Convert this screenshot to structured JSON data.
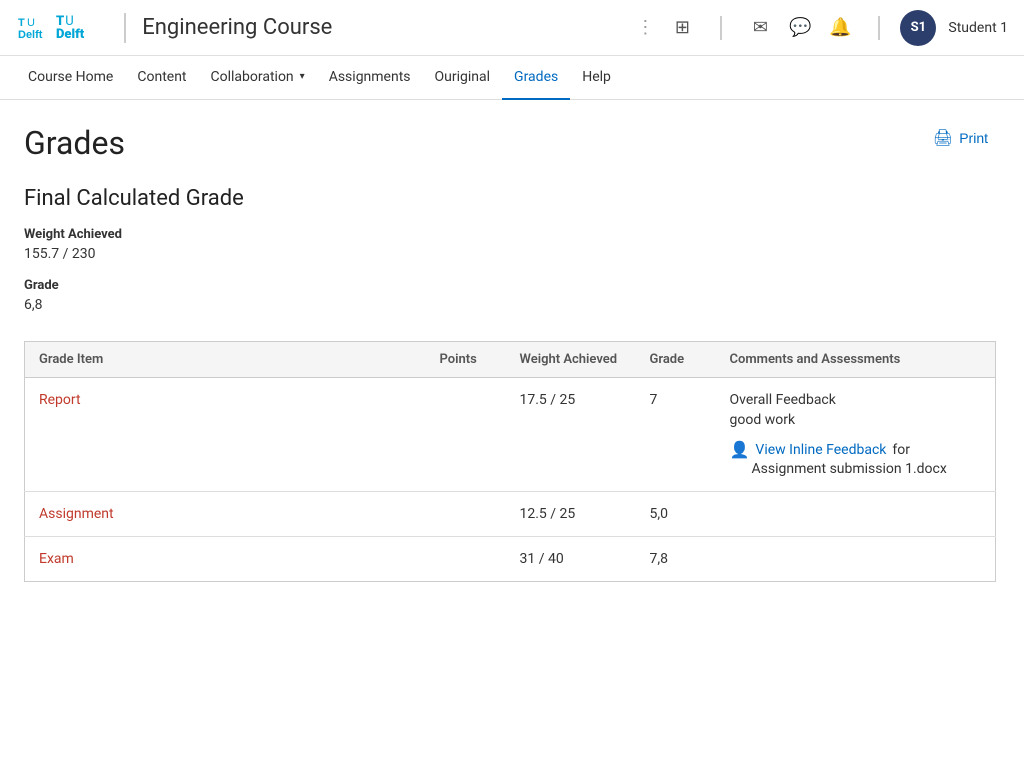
{
  "header": {
    "logo_text": "TUDelft",
    "logo_t": "T",
    "logo_u": "U",
    "logo_delft": "Delft",
    "course_title": "Engineering Course",
    "icons": {
      "grid": "⊞",
      "mail": "✉",
      "chat": "💬",
      "bell": "🔔"
    },
    "user_initials": "S1",
    "user_name": "Student 1"
  },
  "nav": {
    "items": [
      {
        "label": "Course Home",
        "active": false
      },
      {
        "label": "Content",
        "active": false
      },
      {
        "label": "Collaboration",
        "active": false,
        "dropdown": true
      },
      {
        "label": "Assignments",
        "active": false
      },
      {
        "label": "Ouriginal",
        "active": false
      },
      {
        "label": "Grades",
        "active": true
      },
      {
        "label": "Help",
        "active": false
      }
    ]
  },
  "page": {
    "title": "Grades",
    "print_label": "Print"
  },
  "final_grade": {
    "section_title": "Final Calculated Grade",
    "weight_label": "Weight Achieved",
    "weight_value": "155.7 / 230",
    "grade_label": "Grade",
    "grade_value": "6,8"
  },
  "table": {
    "columns": {
      "item": "Grade Item",
      "points": "Points",
      "weight": "Weight Achieved",
      "grade": "Grade",
      "comments": "Comments and Assessments"
    },
    "rows": [
      {
        "item": "Report",
        "points": "",
        "weight": "17.5 / 25",
        "grade": "7",
        "feedback_overall_label": "Overall Feedback",
        "feedback_text": "good work",
        "inline_feedback_label": "View Inline Feedback",
        "inline_feedback_suffix": "for",
        "inline_feedback_file": "Assignment submission 1.docx"
      },
      {
        "item": "Assignment",
        "points": "",
        "weight": "12.5 / 25",
        "grade": "5,0",
        "feedback_overall_label": "",
        "feedback_text": "",
        "inline_feedback_label": "",
        "inline_feedback_suffix": "",
        "inline_feedback_file": ""
      },
      {
        "item": "Exam",
        "points": "",
        "weight": "31 / 40",
        "grade": "7,8",
        "feedback_overall_label": "",
        "feedback_text": "",
        "inline_feedback_label": "",
        "inline_feedback_suffix": "",
        "inline_feedback_file": ""
      }
    ]
  }
}
